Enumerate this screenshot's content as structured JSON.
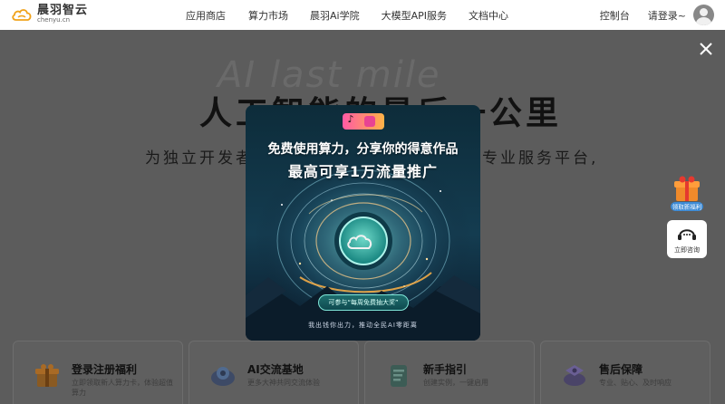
{
  "header": {
    "logo_name": "晨羽智云",
    "logo_domain": "chenyu.cn",
    "nav": [
      "应用商店",
      "算力市场",
      "晨羽Ai学院",
      "大模型API服务",
      "文档中心"
    ],
    "console": "控制台",
    "login": "请登录~"
  },
  "hero": {
    "bg_text": "AI last mile",
    "title": "人工智能的最后一公里",
    "subtitle_left": "为独立开发者",
    "subtitle_right": "专业服务平台,"
  },
  "cards": [
    {
      "title": "登录注册福利",
      "desc": "立即领取新人算力卡，体验超值算力",
      "icon": "gift-box-icon"
    },
    {
      "title": "AI交流基地",
      "desc": "更多大神共同交流体验",
      "icon": "community-icon"
    },
    {
      "title": "新手指引",
      "desc": "创建实例，一键启用",
      "icon": "guide-icon"
    },
    {
      "title": "售后保障",
      "desc": "专业、贴心、及时响应",
      "icon": "support-icon"
    }
  ],
  "floating": {
    "gift_label": "领取新福利",
    "consult_label": "立即咨询"
  },
  "modal": {
    "line1": "免费使用算力，分享你的得意作品",
    "line2": "最高可享1万流量推广",
    "button": "可参与“每周免费抽大奖”",
    "footer": "我出钱你出力，推动全民AI零距离"
  },
  "colors": {
    "overlay": "#5c5c5c",
    "accent": "#7fe6d8"
  }
}
